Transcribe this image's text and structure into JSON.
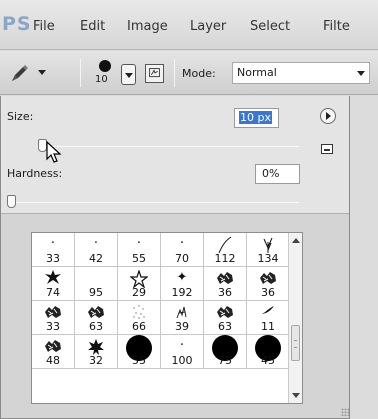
{
  "menubar": {
    "logo": "PS",
    "items": [
      "File",
      "Edit",
      "Image",
      "Layer",
      "Select",
      "Filte"
    ]
  },
  "options": {
    "tool_icon": "brush-icon",
    "brush_size": "10",
    "mode_label": "Mode:",
    "mode_value": "Normal"
  },
  "picker": {
    "size_label": "Size:",
    "size_value": "10 px",
    "size_slider_fraction": 0.02,
    "hardness_label": "Hardness:",
    "hardness_value": "0%",
    "hardness_slider_fraction": 0.0,
    "brushes": [
      {
        "num": "33",
        "glyph": "·",
        "g": "dot-small"
      },
      {
        "num": "42",
        "glyph": "·",
        "g": "dot-small"
      },
      {
        "num": "55",
        "glyph": "·",
        "g": "dot-small"
      },
      {
        "num": "70",
        "glyph": "·",
        "g": "dot-small"
      },
      {
        "num": "112",
        "glyph": "",
        "g": "stroke-curve"
      },
      {
        "num": "134",
        "glyph": "",
        "g": "grass"
      },
      {
        "num": "74",
        "glyph": "✱",
        "g": "star-splat"
      },
      {
        "num": "95",
        "glyph": "",
        "g": "empty"
      },
      {
        "num": "29",
        "glyph": "☆",
        "g": "star-outline"
      },
      {
        "num": "192",
        "glyph": "✦",
        "g": "sparkle"
      },
      {
        "num": "36",
        "glyph": "",
        "g": "leaf-texture"
      },
      {
        "num": "36",
        "glyph": "",
        "g": "leaf-texture"
      },
      {
        "num": "33",
        "glyph": "",
        "g": "leaf-texture"
      },
      {
        "num": "63",
        "glyph": "",
        "g": "leaf-texture"
      },
      {
        "num": "66",
        "glyph": "",
        "g": "scatter-dots"
      },
      {
        "num": "39",
        "glyph": "",
        "g": "grass-small"
      },
      {
        "num": "63",
        "glyph": "",
        "g": "leaf-texture"
      },
      {
        "num": "11",
        "glyph": "",
        "g": "smear"
      },
      {
        "num": "48",
        "glyph": "",
        "g": "leaf-texture"
      },
      {
        "num": "32",
        "glyph": "",
        "g": "maple-leaf"
      },
      {
        "num": "55",
        "glyph": "",
        "g": "solid-circle"
      },
      {
        "num": "100",
        "glyph": "·",
        "g": "dot-small"
      },
      {
        "num": "75",
        "glyph": "",
        "g": "solid-circle"
      },
      {
        "num": "45",
        "glyph": "",
        "g": "solid-circle"
      }
    ]
  }
}
